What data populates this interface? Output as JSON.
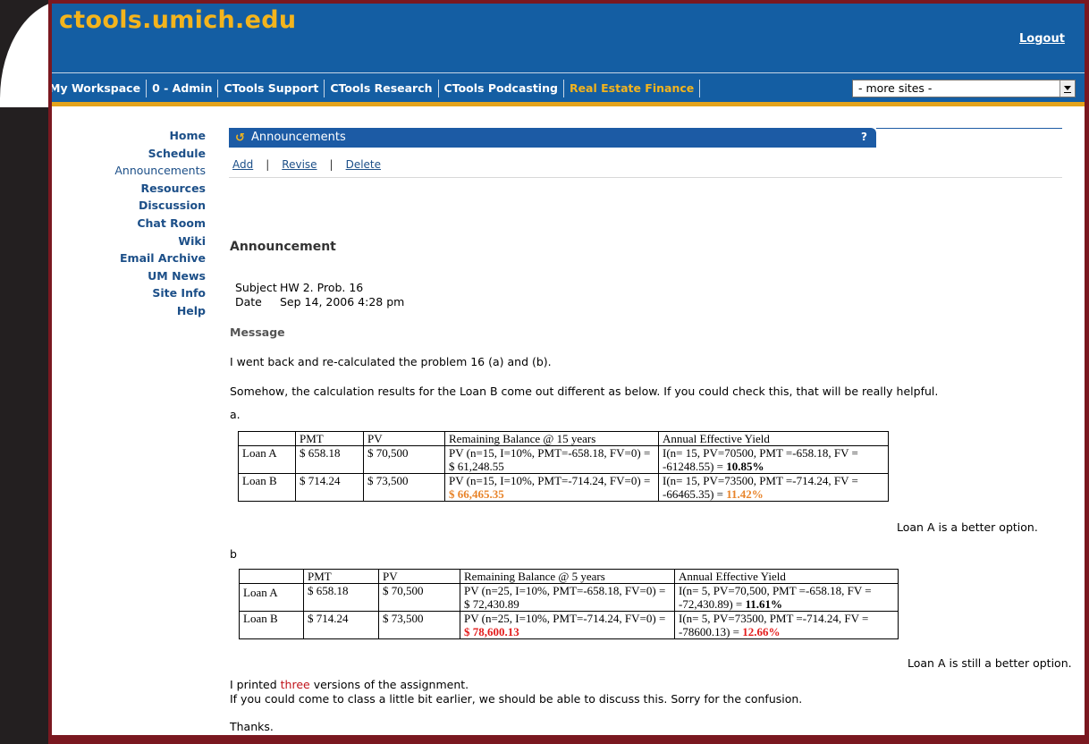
{
  "site": {
    "logo": "ctools.umich.edu",
    "logout": "Logout"
  },
  "tabs": [
    "My Workspace",
    "0 - Admin",
    "CTools Support",
    "CTools Research",
    "CTools Podcasting",
    "Real Estate Finance"
  ],
  "more_sites": "- more sites -",
  "sidebar": [
    "Home",
    "Schedule",
    "Announcements",
    "Resources",
    "Discussion",
    "Chat Room",
    "Wiki",
    "Email Archive",
    "UM News",
    "Site Info",
    "Help"
  ],
  "portlet": {
    "title": "Announcements",
    "help": "?"
  },
  "actions": {
    "add": "Add",
    "revise": "Revise",
    "delete": "Delete"
  },
  "announcement": {
    "heading": "Announcement",
    "subject_label": "Subject",
    "subject": "HW 2. Prob. 16",
    "date_label": "Date",
    "date": "Sep 14, 2006 4:28 pm",
    "message_label": "Message",
    "line1": "I went back and re-calculated the problem 16 (a) and (b).",
    "line2": "Somehow, the calculation results for the Loan B come out different as below.  If you could check this, that will be really helpful.",
    "label_a": "a.",
    "label_b": "b",
    "table_a": {
      "headers": [
        "",
        "PMT",
        "PV",
        "Remaining Balance @ 15 years",
        "Annual Effective Yield"
      ],
      "rows": [
        {
          "loan": "Loan A",
          "pmt": "$ 658.18",
          "pv": "$ 70,500",
          "rb_text": "PV (n=15, I=10%, PMT=-658.18, FV=0) = ",
          "rb_value": "$ 61,248.55",
          "aey_text": "I(n= 15, PV=70500, PMT =-658.18, FV = -61248.55) = ",
          "aey_value": "10.85%"
        },
        {
          "loan": "Loan B",
          "pmt": "$ 714.24",
          "pv": "$ 73,500",
          "rb_text": "PV (n=15, I=10%, PMT=-714.24, FV=0) = ",
          "rb_value": "$ 66,465.35",
          "aey_text": "I(n= 15, PV=73500, PMT =-714.24, FV = -66465.35) = ",
          "aey_value": "11.42%"
        }
      ]
    },
    "note_a": "Loan A is a better option.",
    "table_b": {
      "headers": [
        "",
        "PMT",
        "PV",
        "Remaining Balance @ 5 years",
        "Annual Effective Yield"
      ],
      "rows": [
        {
          "loan": "Loan A",
          "pmt": "$ 658.18",
          "pv": "$ 70,500",
          "rb_text": "PV (n=25, I=10%, PMT=-658.18, FV=0) = ",
          "rb_value": "$ 72,430.89",
          "aey_text": "I(n= 5, PV=70,500, PMT =-658.18, FV = -72,430.89) = ",
          "aey_value": "11.61%"
        },
        {
          "loan": "Loan B",
          "pmt": "$ 714.24",
          "pv": "$ 73,500",
          "rb_text": "PV (n=25, I=10%, PMT=-714.24, FV=0) = ",
          "rb_value": "$ 78,600.13",
          "aey_text": "I(n= 5, PV=73500, PMT =-714.24, FV = -78600.13) = ",
          "aey_value": "12.66%"
        }
      ]
    },
    "note_b": "Loan A is still a better option.",
    "printed_pre": "I printed ",
    "printed_word": "three",
    "printed_post": " versions of the assignment.",
    "line_class": "If you could come to class a little bit earlier, we should be able to discuss this. Sorry for the confusion.",
    "thanks": "Thanks."
  },
  "colors": {
    "header": "#145ea3",
    "logo": "#f3b41d",
    "frame": "#7a1820",
    "orange": "#e8842a",
    "red": "#e31d1d"
  }
}
